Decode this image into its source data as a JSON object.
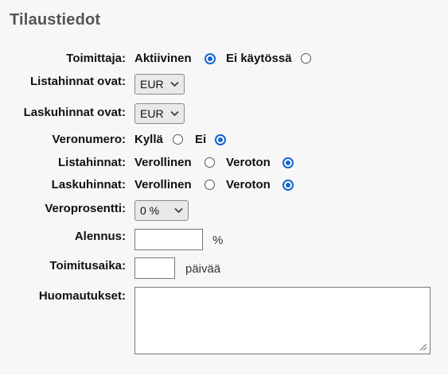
{
  "title": "Tilaustiedot",
  "supplier": {
    "label": "Toimittaja:",
    "opt1": "Aktiivinen",
    "opt2": "Ei käytössä",
    "selected": "Aktiivinen"
  },
  "list_prices": {
    "label": "Listahinnat ovat:",
    "value": "EUR"
  },
  "invoice_prices": {
    "label": "Laskuhinnat ovat:",
    "value": "EUR"
  },
  "tax_number": {
    "label": "Veronumero:",
    "opt1": "Kyllä",
    "opt2": "Ei",
    "selected": "Ei"
  },
  "list_prices_tax": {
    "label": "Listahinnat:",
    "opt1": "Verollinen",
    "opt2": "Veroton",
    "selected": "Veroton"
  },
  "invoice_prices_tax": {
    "label": "Laskuhinnat:",
    "opt1": "Verollinen",
    "opt2": "Veroton",
    "selected": "Veroton"
  },
  "tax_percent": {
    "label": "Veroprosentti:",
    "value": "0 %"
  },
  "discount": {
    "label": "Alennus:",
    "value": "",
    "unit": "%"
  },
  "delivery_time": {
    "label": "Toimitusaika:",
    "value": "",
    "unit": "päivää"
  },
  "notes": {
    "label": "Huomautukset:",
    "value": ""
  },
  "colors": {
    "accent": "#1464d2",
    "title": "#555555",
    "background": "#f7f7f7"
  }
}
